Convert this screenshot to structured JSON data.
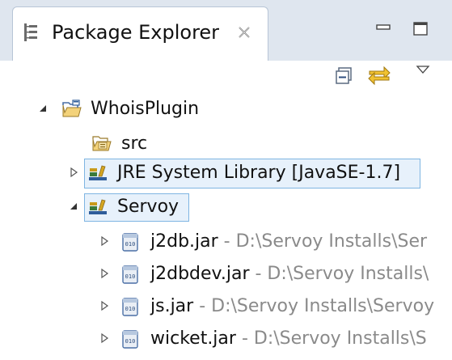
{
  "view": {
    "title": "Package Explorer",
    "icons": {
      "view": "package-explorer-icon",
      "close": "close-icon",
      "minimize": "minimize-icon",
      "maximize": "maximize-icon",
      "collapse_all": "collapse-all-icon",
      "link_with_editor": "link-with-editor-icon",
      "view_menu": "view-menu-icon"
    }
  },
  "tree": {
    "project": {
      "label": "WhoisPlugin",
      "expanded": true,
      "icon": "project-folder-icon"
    },
    "src": {
      "label": "src",
      "icon": "source-folder-icon"
    },
    "jre": {
      "label": "JRE System Library [JavaSE-1.7]",
      "expanded": false,
      "icon": "library-icon"
    },
    "servoy": {
      "label": "Servoy",
      "expanded": true,
      "icon": "library-icon"
    },
    "jars": [
      {
        "name": "j2db.jar",
        "separator": " - ",
        "path": "D:\\Servoy Installs\\Ser",
        "icon": "jar-icon"
      },
      {
        "name": "j2dbdev.jar",
        "separator": " - ",
        "path": "D:\\Servoy Installs\\",
        "icon": "jar-icon"
      },
      {
        "name": "js.jar",
        "separator": " - ",
        "path": "D:\\Servoy Installs\\Servoy",
        "icon": "jar-icon"
      },
      {
        "name": "wicket.jar",
        "separator": " - ",
        "path": "D:\\Servoy Installs\\S",
        "icon": "jar-icon"
      }
    ]
  },
  "colors": {
    "header_bg": "#dfe6ef",
    "selection_border": "#7fb5e2",
    "selection_bg": "#e7f1fb",
    "path_text": "#8a8a8a"
  }
}
